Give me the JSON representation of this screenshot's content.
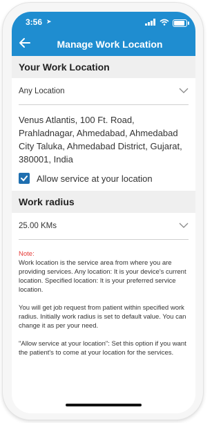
{
  "status_bar": {
    "time": "3:56"
  },
  "header": {
    "title": "Manage Work Location"
  },
  "work_location": {
    "heading": "Your Work Location",
    "selected": "Any Location",
    "address": "Venus Atlantis, 100 Ft. Road, Prahladnagar, Ahmedabad, Ahmedabad City Taluka, Ahmedabad District, Gujarat, 380001, India",
    "allow_service_label": "Allow service at your location",
    "allow_service_checked": true
  },
  "work_radius": {
    "heading": "Work radius",
    "selected": "25.00 KMs"
  },
  "note": {
    "title": "Note:",
    "p1": "Work location is the service area from where you are providing services. Any location: It is your device's current location. Specified location: It is your preferred service location.",
    "p2": "You will get job request from patient within specified work radius. Initially work radius is set to default value. You can change it as per your need.",
    "p3": "\"Allow service at your location\": Set this option if you want the patient's to come at your location for the services."
  },
  "colors": {
    "primary": "#1f8dd0",
    "checkbox": "#1f6fb0",
    "note_title": "#e53935"
  }
}
